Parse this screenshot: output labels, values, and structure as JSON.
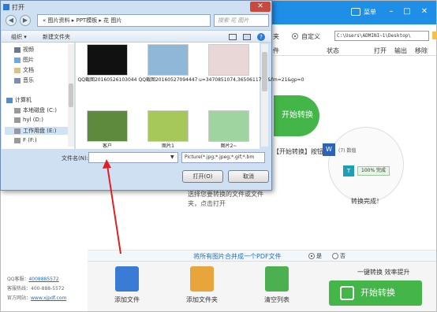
{
  "app": {
    "menu_label": "菜单",
    "path_option": "自定义",
    "path_left_label": "夹",
    "output_path": "C:\\Users\\ADMINI~1\\Desktop\\",
    "columns": [
      "件",
      "状态",
      "打开",
      "输出",
      "移除"
    ],
    "convert_badge": "开始转换",
    "convert_hint": "【开始转换】按钮",
    "done_label": "转换完成！",
    "progress_tip": "100%  完成",
    "counter": "(7) 数值",
    "hint_text": "选择您要转换的文件或文件夹，点击打开",
    "merge_label": "将所有图片合并成一个PDF文件",
    "merge_yes": "是",
    "merge_no": "否",
    "support": [
      {
        "label": "QQ客服：",
        "value": "4008885572"
      },
      {
        "label": "客服热线：",
        "value": "400-888-5572"
      },
      {
        "label": "官方网站：",
        "value": "www.xjpdf.com"
      }
    ],
    "tools": [
      "添加文件",
      "添加文件夹",
      "清空列表"
    ],
    "slogan": "一键转换  效率提升",
    "start_button": "开始转换",
    "brand_color": "#43b549",
    "title_color": "#1e8ee6"
  },
  "dialog": {
    "title": "打开",
    "breadcrumb": "«  图片资料  ▸  PPT模板  ▸  花 图片",
    "search_placeholder": "搜索 花 图片",
    "organize": "组织 ▾",
    "new_folder": "新建文件夹",
    "nav": [
      {
        "label": "视频",
        "icon": "video-icon"
      },
      {
        "label": "图片",
        "icon": "picture-icon"
      },
      {
        "label": "文档",
        "icon": "document-icon"
      },
      {
        "label": "音乐",
        "icon": "music-icon"
      },
      {
        "label": "计算机",
        "icon": "computer-icon"
      },
      {
        "label": "本地磁盘 (C:)",
        "icon": "drive-icon"
      },
      {
        "label": "hyl (D:)",
        "icon": "drive-icon"
      },
      {
        "label": "工作用盘 (E:)",
        "icon": "drive-icon"
      },
      {
        "label": "F (F:)",
        "icon": "drive-icon"
      }
    ],
    "files": [
      {
        "name": "QQ截图20160526103044"
      },
      {
        "name": "QQ截图20160527094447"
      },
      {
        "name": "u=3470851074,3650611708&fm=21&gp=0"
      },
      {
        "name": "客户"
      },
      {
        "name": "图片1"
      },
      {
        "name": "图片2~"
      }
    ],
    "filename_label": "文件名(N):",
    "filename_value": "",
    "filetype": "Picture(*.jpg;*.jpeg;*.gif;*.bm",
    "open_button": "打开(O)",
    "cancel_button": "取消"
  }
}
